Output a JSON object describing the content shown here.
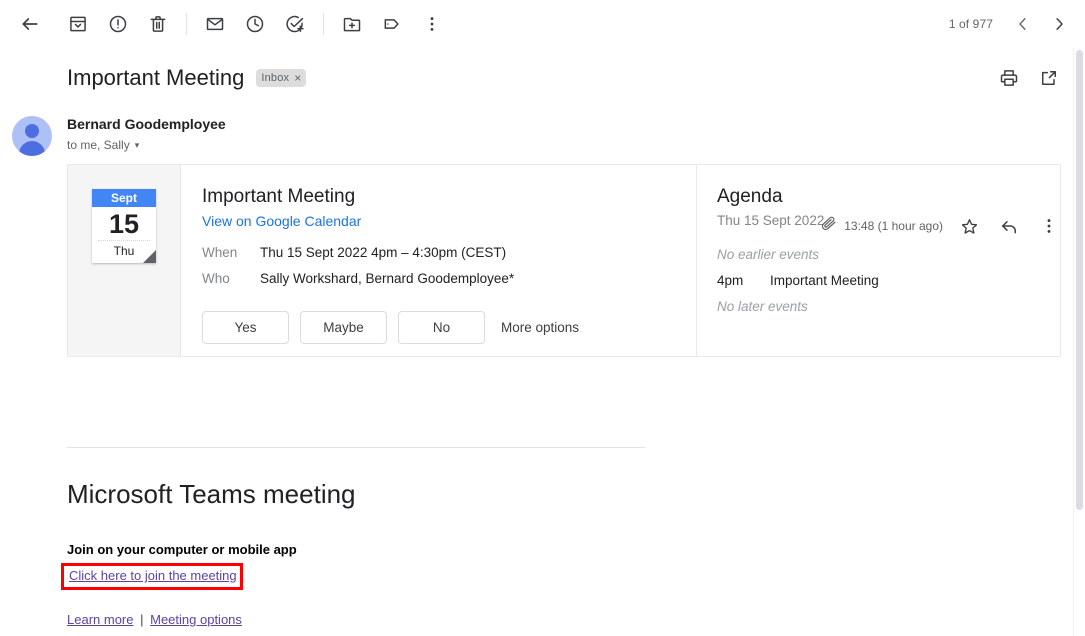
{
  "toolbar": {
    "back": "back-arrow",
    "actions": [
      {
        "name": "archive-icon",
        "title": "Archive"
      },
      {
        "name": "report-spam-icon",
        "title": "Report spam"
      },
      {
        "name": "delete-icon",
        "title": "Delete"
      },
      {
        "name": "mark-unread-icon",
        "title": "Mark as unread"
      },
      {
        "name": "snooze-icon",
        "title": "Snooze"
      },
      {
        "name": "add-to-tasks-icon",
        "title": "Add to tasks"
      },
      {
        "name": "move-to-icon",
        "title": "Move to"
      },
      {
        "name": "labels-icon",
        "title": "Labels"
      },
      {
        "name": "more-icon",
        "title": "More"
      }
    ],
    "pager_count": "1 of 977",
    "prev_label": "‹",
    "next_label": "›"
  },
  "subject": {
    "title": "Important Meeting",
    "label_chip": "Inbox",
    "label_chip_remove": "×",
    "print_title": "Print all",
    "popout_title": "Open in new window"
  },
  "message": {
    "sender": "Bernard Goodemployee",
    "recipients": "to me, Sally",
    "recipients_caret": "▾",
    "time": "13:48 (1 hour ago)",
    "attachment_icon": "paperclip-icon",
    "star_icon": "star-icon",
    "reply_icon": "reply-icon",
    "more_icon": "more-vertical-icon"
  },
  "invite": {
    "calendar": {
      "month": "Sept",
      "day": "15",
      "weekday": "Thu"
    },
    "event_title": "Important Meeting",
    "calendar_link": "View on Google Calendar",
    "when_label": "When",
    "when_value": "Thu 15 Sept 2022 4pm – 4:30pm (CEST)",
    "who_label": "Who",
    "who_value": "Sally Workshard, Bernard Goodemployee*",
    "rsvp": {
      "yes": "Yes",
      "maybe": "Maybe",
      "no": "No",
      "more": "More options"
    },
    "agenda": {
      "title": "Agenda",
      "date": "Thu 15 Sept 2022",
      "no_earlier": "No earlier events",
      "event_time": "4pm",
      "event_name": "Important Meeting",
      "no_later": "No later events"
    }
  },
  "body": {
    "teams_heading": "Microsoft Teams meeting",
    "join_subheading": "Join on your computer or mobile app",
    "join_link": "Click here to join the meeting",
    "learn_more": "Learn more",
    "separator": "|",
    "meeting_options": "Meeting options"
  },
  "colors": {
    "calendar_blue": "#4285f4",
    "link_blue": "#1a73e8",
    "visited_purple": "#5c42a5",
    "highlight_red": "#ff0000",
    "avatar_bg": "#aec1f7",
    "avatar_fg": "#4c6ee0"
  }
}
